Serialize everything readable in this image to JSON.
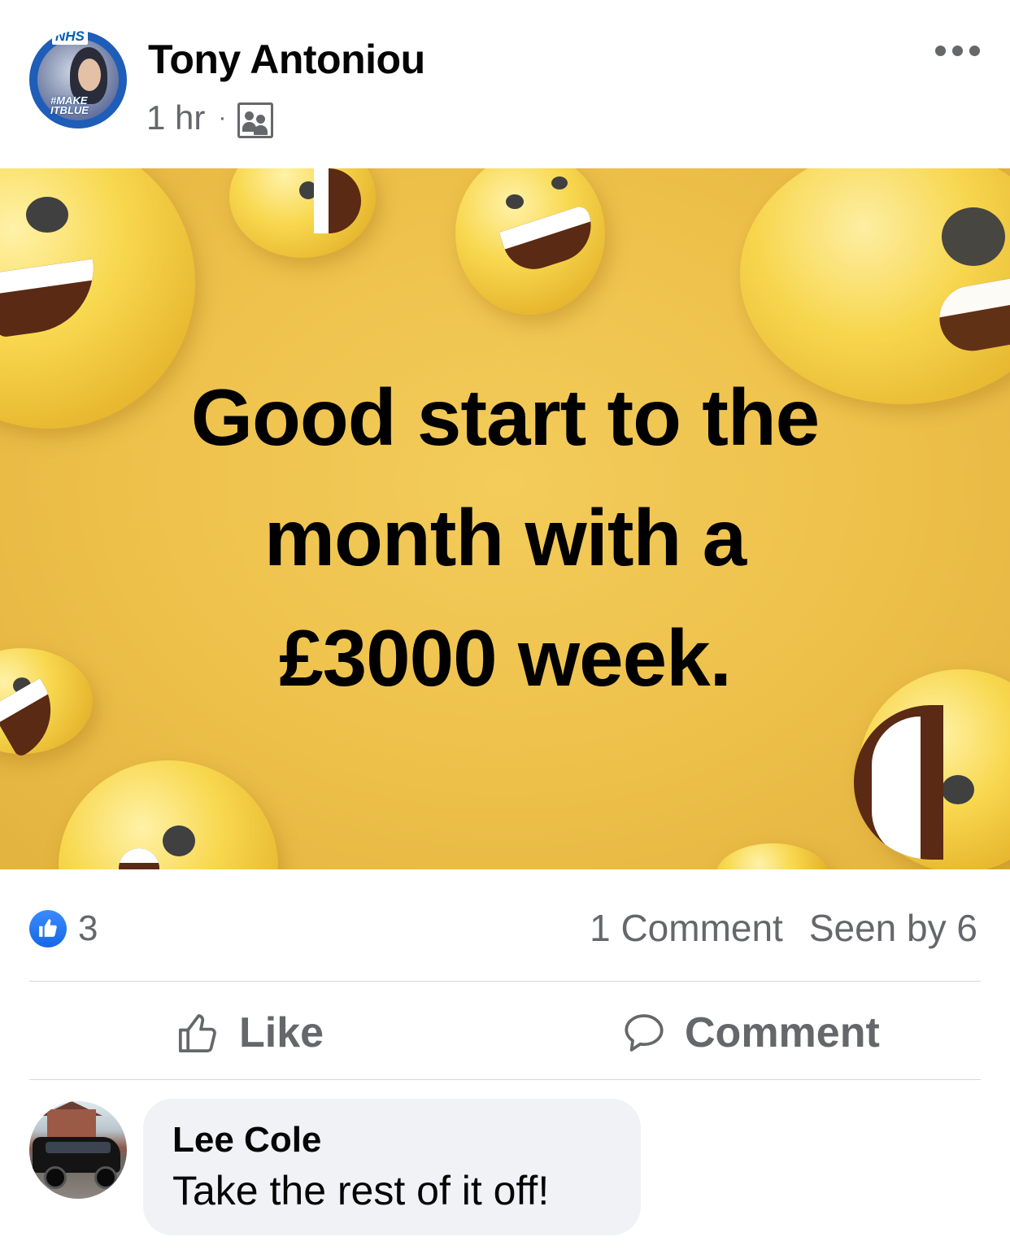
{
  "post": {
    "author": "Tony Antoniou",
    "time": "1 hr",
    "separator": "·",
    "audience_icon": "custom-audience-icon",
    "avatar_badge": "NHS",
    "avatar_tag_line1": "#MAKE",
    "avatar_tag_line2": "ITBLUE",
    "image_text": [
      "Good start to the",
      "month with a",
      "£3000 week."
    ],
    "image_background_color": "#EDC04A"
  },
  "stats": {
    "like_count": "3",
    "comments": "1 Comment",
    "seen_by": "Seen by 6"
  },
  "actions": {
    "like": "Like",
    "comment": "Comment"
  },
  "comment": {
    "author": "Lee Cole",
    "text": "Take the rest of it off!"
  },
  "colors": {
    "secondary_text": "#65676B",
    "like_blue": "#1877F2",
    "bubble_bg": "#F0F2F5"
  }
}
